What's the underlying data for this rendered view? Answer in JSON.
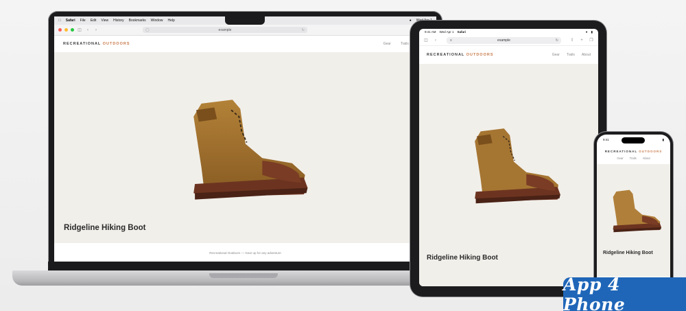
{
  "site": {
    "logo_main": "RECREATIONAL",
    "logo_accent": "OUTDOORS",
    "nav": [
      "Gear",
      "Trails",
      "About"
    ],
    "product_title": "Ridgeline Hiking Boot",
    "footer_text": "Recreational Outdoors — Gear up for any adventure",
    "accent_color": "#c87a4a"
  },
  "mac": {
    "menu_items": [
      "Safari",
      "File",
      "Edit",
      "View",
      "History",
      "Bookmarks",
      "Window",
      "Help"
    ],
    "clock": "Wed Apr 1",
    "address": "example"
  },
  "ipad": {
    "time": "9:41 AM",
    "date": "Wed Apr 1",
    "app": "Safari",
    "address": "example"
  },
  "iphone": {
    "time": "9:41"
  },
  "badge": {
    "text": "App 4 Phone",
    "color": "#1f66b8"
  },
  "icons": [
    "apple-icon",
    "wifi-icon",
    "battery-icon",
    "sidebar-icon",
    "back-icon",
    "forward-icon",
    "reload-icon",
    "share-icon",
    "plus-icon",
    "tabs-icon",
    "reader-icon",
    "shield-icon"
  ]
}
